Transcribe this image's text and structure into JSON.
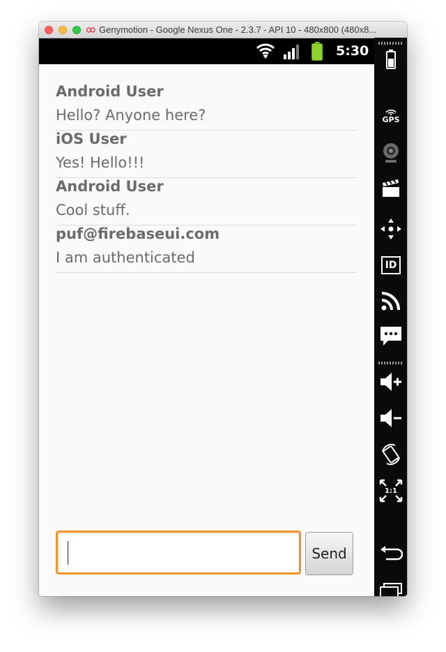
{
  "window": {
    "title": "Genymotion - Google Nexus One - 2.3.7 - API 10 - 480x800 (480x8...",
    "app_icon": "genymotion-logo-icon"
  },
  "status_bar": {
    "time": "5:30",
    "icons": [
      "wifi-icon",
      "signal-icon",
      "battery-icon"
    ]
  },
  "messages": [
    {
      "author": "Android User",
      "text": "Hello? Anyone here?"
    },
    {
      "author": "iOS User",
      "text": "Yes! Hello!!!"
    },
    {
      "author": "Android User",
      "text": "Cool stuff."
    },
    {
      "author": "puf@firebaseui.com",
      "text": "I am authenticated"
    }
  ],
  "composer": {
    "input_value": "",
    "send_label": "Send"
  },
  "toolbar": {
    "gps_label": "GPS",
    "id_label": "ID",
    "ratio_label": "1:1",
    "icons": [
      "battery-icon",
      "gps-icon",
      "webcam-icon",
      "media-clapper-icon",
      "dpad-icon",
      "device-id-icon",
      "rss-icon",
      "sms-icon",
      "volume-up-icon",
      "volume-down-icon",
      "rotate-icon",
      "pixel-perfect-icon",
      "back-icon",
      "recent-apps-icon"
    ]
  },
  "colors": {
    "input_focus_border": "#f0962a",
    "text": "#6b6b6b",
    "status_bar": "#000000",
    "battery_green": "#8ed12c"
  }
}
